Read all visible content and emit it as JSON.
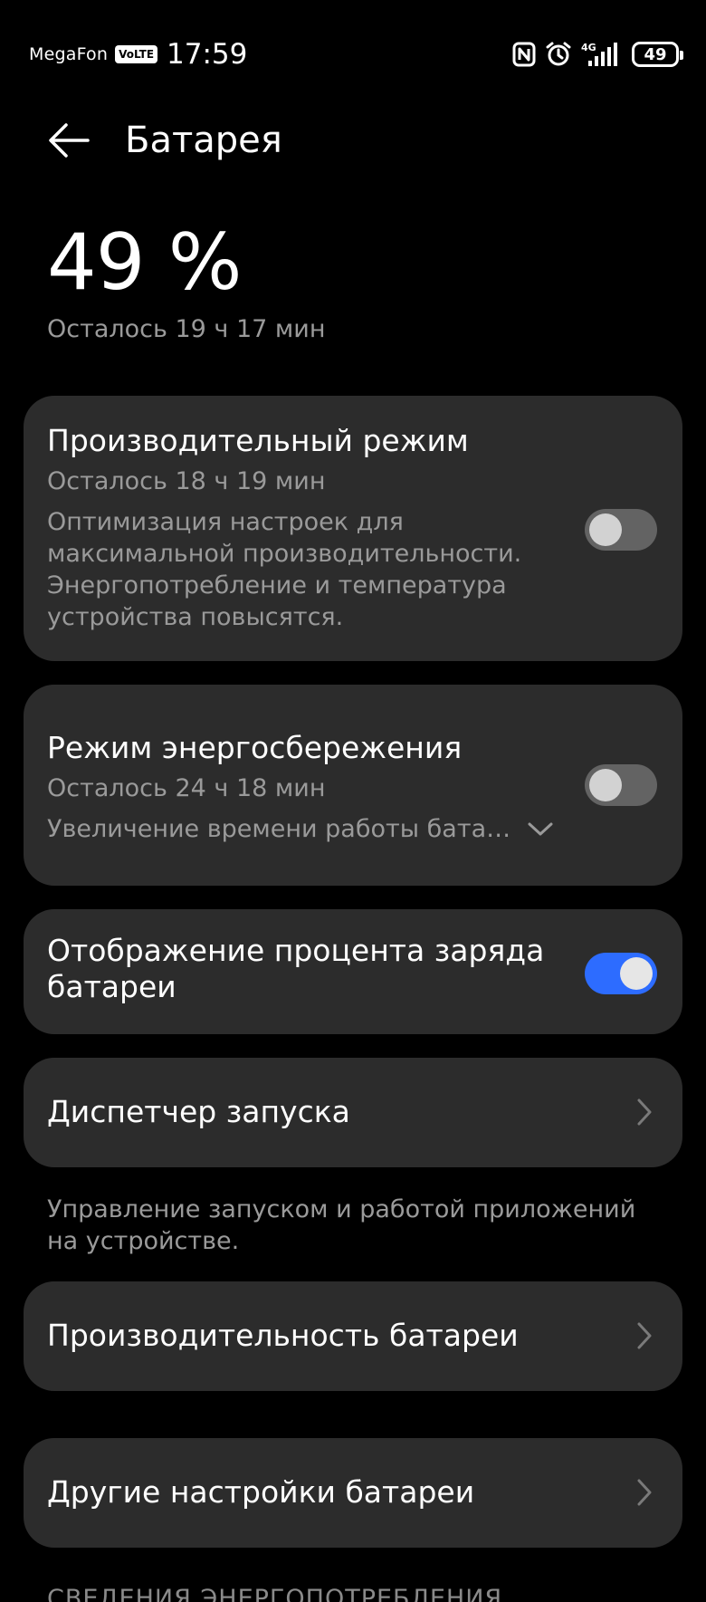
{
  "status_bar": {
    "carrier": "MegaFon",
    "volte": "VoLTE",
    "time": "17:59",
    "network": "4G",
    "battery_level": "49",
    "icons": [
      "nfc-icon",
      "alarm-icon",
      "signal-icon",
      "battery-icon"
    ]
  },
  "header": {
    "title": "Батарея",
    "back_icon": "arrow-left-icon"
  },
  "battery": {
    "percent": "49 %",
    "remaining": "Осталось 19 ч 17 мин"
  },
  "performance_mode": {
    "title": "Производительный режим",
    "remaining": "Осталось 18 ч 19 мин",
    "description_lines": [
      "Оптимизация настроек для",
      "максимальной производительности.",
      "Энергопотребление и температура",
      "устройства повысятся."
    ],
    "enabled": false
  },
  "power_saving": {
    "title": "Режим энергосбережения",
    "remaining": "Осталось 24 ч 18 мин",
    "description": "Увеличение времени работы бата…",
    "enabled": false
  },
  "battery_percent_display": {
    "title_lines": [
      "Отображение процента заряда",
      "батареи"
    ],
    "enabled": true
  },
  "launch_manager": {
    "title": "Диспетчер запуска",
    "note_lines": [
      "Управление запуском и работой приложений",
      "на устройстве."
    ]
  },
  "battery_performance": {
    "title": "Производительность батареи"
  },
  "other_settings": {
    "title": "Другие настройки батареи"
  },
  "next_section": {
    "heading": "СВЕДЕНИЯ ЭНЕРГОПОТРЕБЛЕНИЯ"
  },
  "colors": {
    "background": "#000000",
    "card": "#2c2c2c",
    "secondary_text": "#9a9a9a",
    "toggle_on": "#2d6cff",
    "toggle_off": "#636363"
  }
}
